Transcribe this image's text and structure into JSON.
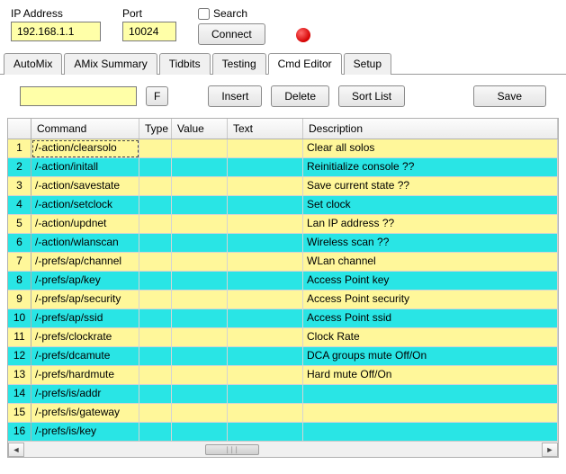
{
  "top": {
    "ip_label": "IP Address",
    "ip_value": "192.168.1.1",
    "port_label": "Port",
    "port_value": "10024",
    "search_label": "Search",
    "connect_label": "Connect"
  },
  "tabs": [
    {
      "label": "AutoMix"
    },
    {
      "label": "AMix Summary"
    },
    {
      "label": "Tidbits"
    },
    {
      "label": "Testing"
    },
    {
      "label": "Cmd Editor"
    },
    {
      "label": "Setup"
    }
  ],
  "active_tab": 4,
  "toolbar": {
    "filter_value": "",
    "f_label": "F",
    "insert_label": "Insert",
    "delete_label": "Delete",
    "sort_label": "Sort List",
    "save_label": "Save"
  },
  "grid": {
    "headers": {
      "command": "Command",
      "type": "Type",
      "value": "Value",
      "text": "Text",
      "description": "Description"
    },
    "rows": [
      {
        "n": 1,
        "cmd": "/-action/clearsolo",
        "type": "",
        "value": "",
        "text": "",
        "desc": "Clear all solos",
        "color": "yellow",
        "focus": true
      },
      {
        "n": 2,
        "cmd": "/-action/initall",
        "type": "",
        "value": "",
        "text": "",
        "desc": "Reinitialize console ??",
        "color": "cyan"
      },
      {
        "n": 3,
        "cmd": "/-action/savestate",
        "type": "",
        "value": "",
        "text": "",
        "desc": "Save current state ??",
        "color": "yellow"
      },
      {
        "n": 4,
        "cmd": "/-action/setclock",
        "type": "",
        "value": "",
        "text": "",
        "desc": "Set clock",
        "color": "cyan"
      },
      {
        "n": 5,
        "cmd": "/-action/updnet",
        "type": "",
        "value": "",
        "text": "",
        "desc": "Lan IP address ??",
        "color": "yellow"
      },
      {
        "n": 6,
        "cmd": "/-action/wlanscan",
        "type": "",
        "value": "",
        "text": "",
        "desc": "Wireless scan ??",
        "color": "cyan"
      },
      {
        "n": 7,
        "cmd": "/-prefs/ap/channel",
        "type": "",
        "value": "",
        "text": "",
        "desc": "WLan channel",
        "color": "yellow"
      },
      {
        "n": 8,
        "cmd": "/-prefs/ap/key",
        "type": "",
        "value": "",
        "text": "",
        "desc": "Access Point key",
        "color": "cyan"
      },
      {
        "n": 9,
        "cmd": "/-prefs/ap/security",
        "type": "",
        "value": "",
        "text": "",
        "desc": "Access Point security",
        "color": "yellow"
      },
      {
        "n": 10,
        "cmd": "/-prefs/ap/ssid",
        "type": "",
        "value": "",
        "text": "",
        "desc": "Access Point ssid",
        "color": "cyan"
      },
      {
        "n": 11,
        "cmd": "/-prefs/clockrate",
        "type": "",
        "value": "",
        "text": "",
        "desc": "Clock Rate",
        "color": "yellow"
      },
      {
        "n": 12,
        "cmd": "/-prefs/dcamute",
        "type": "",
        "value": "",
        "text": "",
        "desc": "DCA groups mute Off/On",
        "color": "cyan"
      },
      {
        "n": 13,
        "cmd": "/-prefs/hardmute",
        "type": "",
        "value": "",
        "text": "",
        "desc": "Hard mute Off/On",
        "color": "yellow"
      },
      {
        "n": 14,
        "cmd": "/-prefs/is/addr",
        "type": "",
        "value": "",
        "text": "",
        "desc": "",
        "color": "cyan"
      },
      {
        "n": 15,
        "cmd": "/-prefs/is/gateway",
        "type": "",
        "value": "",
        "text": "",
        "desc": "",
        "color": "yellow"
      },
      {
        "n": 16,
        "cmd": "/-prefs/is/key",
        "type": "",
        "value": "",
        "text": "",
        "desc": "",
        "color": "cyan"
      }
    ]
  }
}
